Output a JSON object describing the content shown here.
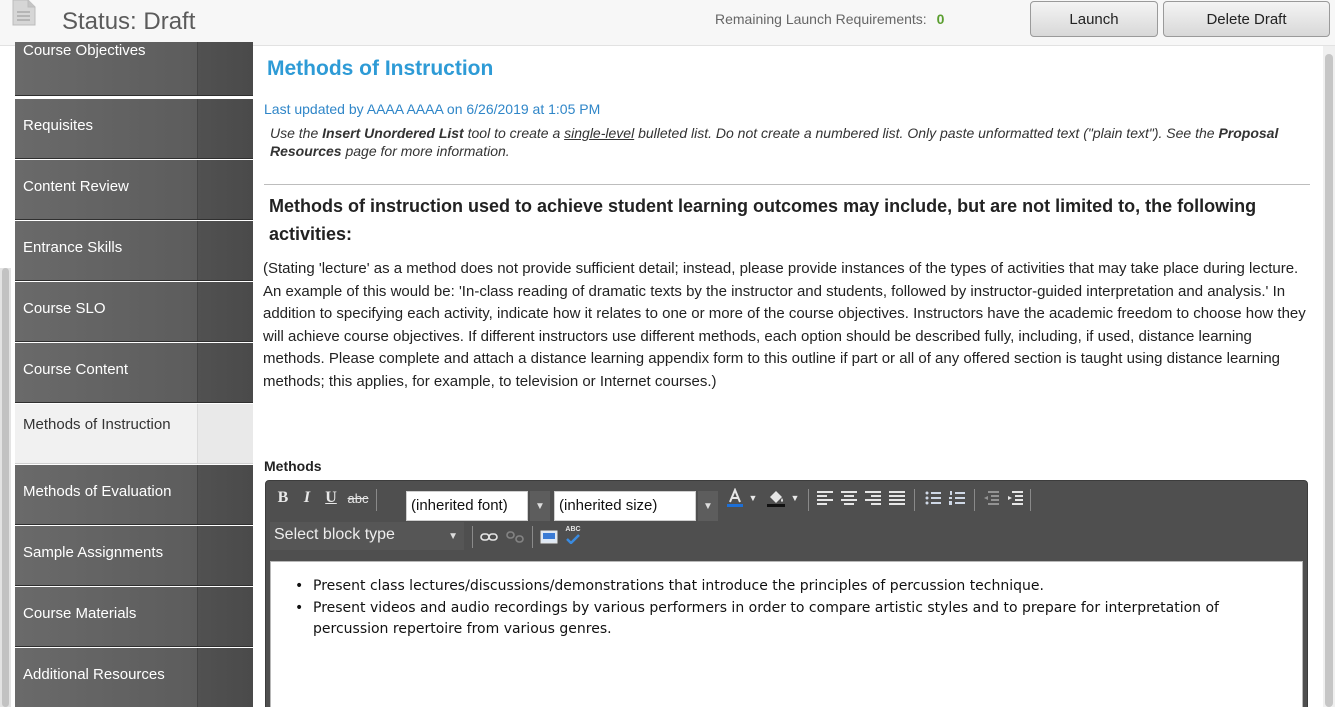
{
  "header": {
    "status_title": "Status: Draft",
    "launch_requirements_label": "Remaining Launch Requirements:",
    "launch_requirements_count": "0",
    "launch_button": "Launch",
    "delete_button": "Delete Draft"
  },
  "sidebar": {
    "items": [
      {
        "label": "Course Objectives",
        "active": false
      },
      {
        "label": "Requisites",
        "active": false
      },
      {
        "label": "Content Review",
        "active": false
      },
      {
        "label": "Entrance Skills",
        "active": false
      },
      {
        "label": "Course SLO",
        "active": false
      },
      {
        "label": "Course Content",
        "active": false
      },
      {
        "label": "Methods of Instruction",
        "active": true
      },
      {
        "label": "Methods of Evaluation",
        "active": false
      },
      {
        "label": "Sample Assignments",
        "active": false
      },
      {
        "label": "Course Materials",
        "active": false
      },
      {
        "label": "Additional Resources",
        "active": false
      }
    ]
  },
  "main": {
    "title": "Methods of Instruction",
    "last_updated": "Last updated by AAAA AAAA on 6/26/2019 at 1:05 PM",
    "instructions": {
      "p1": "Use the ",
      "b1": "Insert Unordered List",
      "p2": " tool to create a ",
      "u1": "single-level",
      "p3": " bulleted list. Do not create a numbered list. Only paste unformatted text (\"plain text\"). See the ",
      "b2": "Proposal Resources",
      "p4": " page for more information."
    },
    "question": "Methods of instruction used to achieve student learning outcomes may include, but are not limited to, the following activities:",
    "guidance": "(Stating 'lecture' as a method does not provide sufficient detail; instead, please provide instances of the types of activities that may take place during lecture. An example of this would be: 'In-class reading of dramatic texts by the instructor and students, followed by instructor-guided interpretation and analysis.' In addition to specifying each activity, indicate how it relates to one or more of the course objectives. Instructors have the academic freedom to choose how they will achieve course objectives. If different instructors use different methods, each option should be described fully, including, if used, distance learning methods. Please complete and attach a distance learning appendix form to this outline if part or all of any offered section is taught using distance learning methods; this applies, for example, to television or Internet courses.)",
    "field_label": "Methods"
  },
  "editor": {
    "bold": "B",
    "italic": "I",
    "underline": "U",
    "strike": "abc",
    "font_select": "(inherited font)",
    "size_select": "(inherited size)",
    "block_select": "Select block type",
    "spell_label": "ABC",
    "bullets": [
      "Present class lectures/discussions/demonstrations that introduce the principles of percussion technique.",
      "Present videos and audio recordings by various performers in order to compare artistic styles and to prepare for interpretation of percussion repertoire from various genres."
    ],
    "colors": {
      "toolbar": "#4f4f4f",
      "font_color_bar": "#1d6fd6"
    }
  }
}
